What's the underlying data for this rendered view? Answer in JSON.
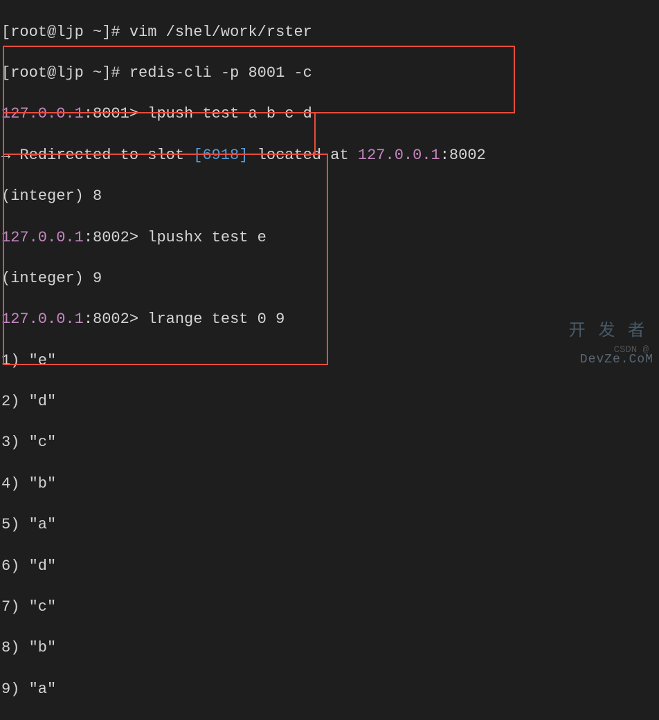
{
  "shell": {
    "line1": {
      "prompt_open": "[",
      "user": "root",
      "at": "@",
      "host": "ljp",
      "path": " ~",
      "prompt_close": "]# ",
      "cmd": "vim /shel/work/rster"
    },
    "line2": {
      "prompt_open": "[",
      "user": "root",
      "at": "@",
      "host": "ljp",
      "path": " ~",
      "prompt_close": "]# ",
      "cmd": "redis-cli -p 8001 -c"
    }
  },
  "redis": {
    "block1": {
      "ip": "127.0.0.1",
      "colon": ":",
      "port": "8001",
      "gt": "> ",
      "cmd": "lpush test a b c d",
      "redirect_arrow": "→ ",
      "redirect_text_a": "Redirected to slot ",
      "slot": "[6918]",
      "redirect_text_b": " located at ",
      "located_ip": "127.0.0.1",
      "located_port": ":8002",
      "result": "(integer) 8"
    },
    "block2": {
      "ip": "127.0.0.1",
      "colon": ":",
      "port": "8002",
      "gt": "> ",
      "cmd": "lpushx test e",
      "result": "(integer) 9"
    },
    "block3": {
      "ip": "127.0.0.1",
      "colon": ":",
      "port": "8002",
      "gt": "> ",
      "cmd": "lrange test 0 9",
      "r1": "1) \"e\"",
      "r2": "2) \"d\"",
      "r3": "3) \"c\"",
      "r4": "4) \"b\"",
      "r5": "5) \"a\"",
      "r6": "6) \"d\"",
      "r7": "7) \"c\"",
      "r8": "8) \"b\"",
      "r9": "9) \"a\""
    }
  },
  "watermark": {
    "cn": "开 发 者",
    "csdn": "CSDN @",
    "devze": "DevZe.CoM"
  }
}
